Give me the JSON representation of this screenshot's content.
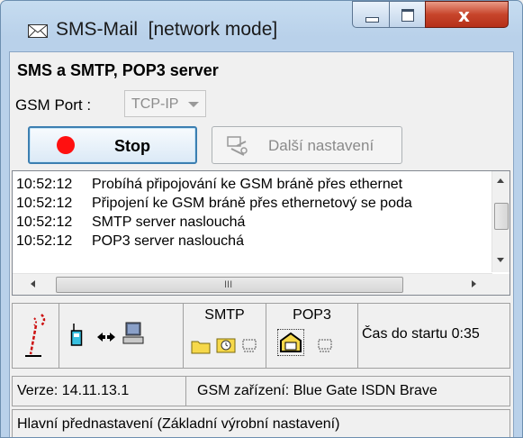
{
  "window": {
    "title": "SMS-Mail  [network mode]",
    "title_icon": "envelope-icon",
    "caption_buttons": [
      "minimize",
      "maximize",
      "close"
    ]
  },
  "panel": {
    "heading": "SMS a SMTP, POP3 server",
    "gsm_port_label": "GSM Port :",
    "gsm_port_value": "TCP-IP"
  },
  "buttons": {
    "stop_label": "Stop",
    "more_settings_label": "Další nastavení"
  },
  "log": [
    {
      "time": "10:52:12",
      "text": "Probíhá připojování ke GSM bráně přes ethernet"
    },
    {
      "time": "10:52:12",
      "text": "Připojení ke GSM bráně přes ethernetový se poda"
    },
    {
      "time": "10:52:12",
      "text": "SMTP server naslouchá"
    },
    {
      "time": "10:52:12",
      "text": "POP3 server naslouchá"
    }
  ],
  "scroll": {
    "h_grip": "III"
  },
  "status_panel": {
    "smtp_label": "SMTP",
    "pop3_label": "POP3",
    "uptime": "Čas do startu 0:35"
  },
  "statusbar": {
    "version": "Verze: 14.11.13.1",
    "device": "GSM zařízení: Blue Gate ISDN Brave",
    "preset": "Hlavní přednastavení (Základní výrobní nastavení)"
  },
  "colors": {
    "stop_dot": "#ff1010",
    "title_bar": "#b9d1ea",
    "close_button": "#c7452b"
  }
}
